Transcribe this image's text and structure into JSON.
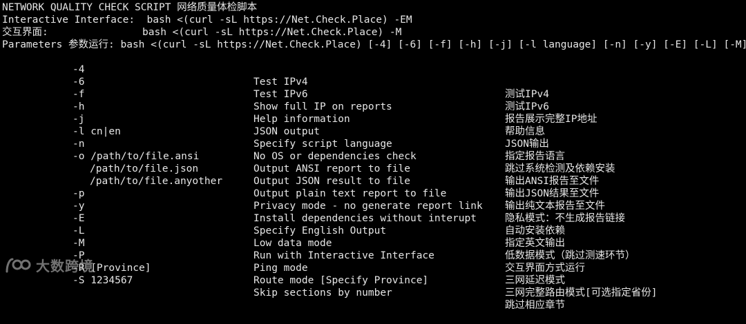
{
  "terminal": {
    "header": {
      "title": "NETWORK QUALITY CHECK SCRIPT 网络质量体检脚本",
      "interactive_label": "Interactive Interface:",
      "interactive_cmd": "bash <(curl -sL https://Net.Check.Place) -EM",
      "interactive_zh_label": "交互界面:",
      "interactive_zh_cmd": "bash <(curl -sL https://Net.Check.Place) -M",
      "params": "Parameters 参数运行: bash <(curl -sL https://Net.Check.Place) [-4] [-6] [-f] [-h] [-j] [-l language] [-n] [-y] [-E] [-L] [-M] [-"
    },
    "options": [
      {
        "flag": "-4",
        "en": "Test IPv4",
        "zh": "测试IPv4"
      },
      {
        "flag": "-6",
        "en": "Test IPv6",
        "zh": "测试IPv6"
      },
      {
        "flag": "-f",
        "en": "Show full IP on reports",
        "zh": "报告展示完整IP地址"
      },
      {
        "flag": "-h",
        "en": "Help information",
        "zh": "帮助信息"
      },
      {
        "flag": "-j",
        "en": "JSON output",
        "zh": "JSON输出"
      },
      {
        "flag": "-l cn|en",
        "en": "Specify script language",
        "zh": "指定报告语言"
      },
      {
        "flag": "-n",
        "en": "No OS or dependencies check",
        "zh": "跳过系统检测及依赖安装"
      },
      {
        "flag": "-o /path/to/file.ansi",
        "en": "Output ANSI report to file",
        "zh": "输出ANSI报告至文件"
      },
      {
        "flag": "/path/to/file.json",
        "en": "Output JSON result to file",
        "zh": "输出JSON结果至文件"
      },
      {
        "flag": "/path/to/file.anyother",
        "en": "Output plain text report to file",
        "zh": "输出纯文本报告至文件"
      },
      {
        "flag": "-p",
        "en": "Privacy mode - no generate report link",
        "zh": "隐私模式：不生成报告链接"
      },
      {
        "flag": "-y",
        "en": "Install dependencies without interupt",
        "zh": "自动安装依赖"
      },
      {
        "flag": "-E",
        "en": "Specify English Output",
        "zh": "指定英文输出"
      },
      {
        "flag": "-L",
        "en": "Low data mode",
        "zh": "低数据模式（跳过测速环节）"
      },
      {
        "flag": "-M",
        "en": "Run with Interactive Interface",
        "zh": "交互界面方式运行"
      },
      {
        "flag": "-P",
        "en": "Ping mode",
        "zh": "三网延迟模式"
      },
      {
        "flag": "-R [Province]",
        "en": "Route mode [Specify Province]",
        "zh": "三网完整路由模式[可选指定省份]"
      },
      {
        "flag": "-S 1234567",
        "en": "Skip sections by number",
        "zh": "跳过相应章节"
      }
    ]
  },
  "watermark": {
    "text": "大数跨境",
    "icon": "watermark-logo-icon"
  },
  "colors": {
    "background": "#000000",
    "foreground": "#e6e6e6"
  }
}
